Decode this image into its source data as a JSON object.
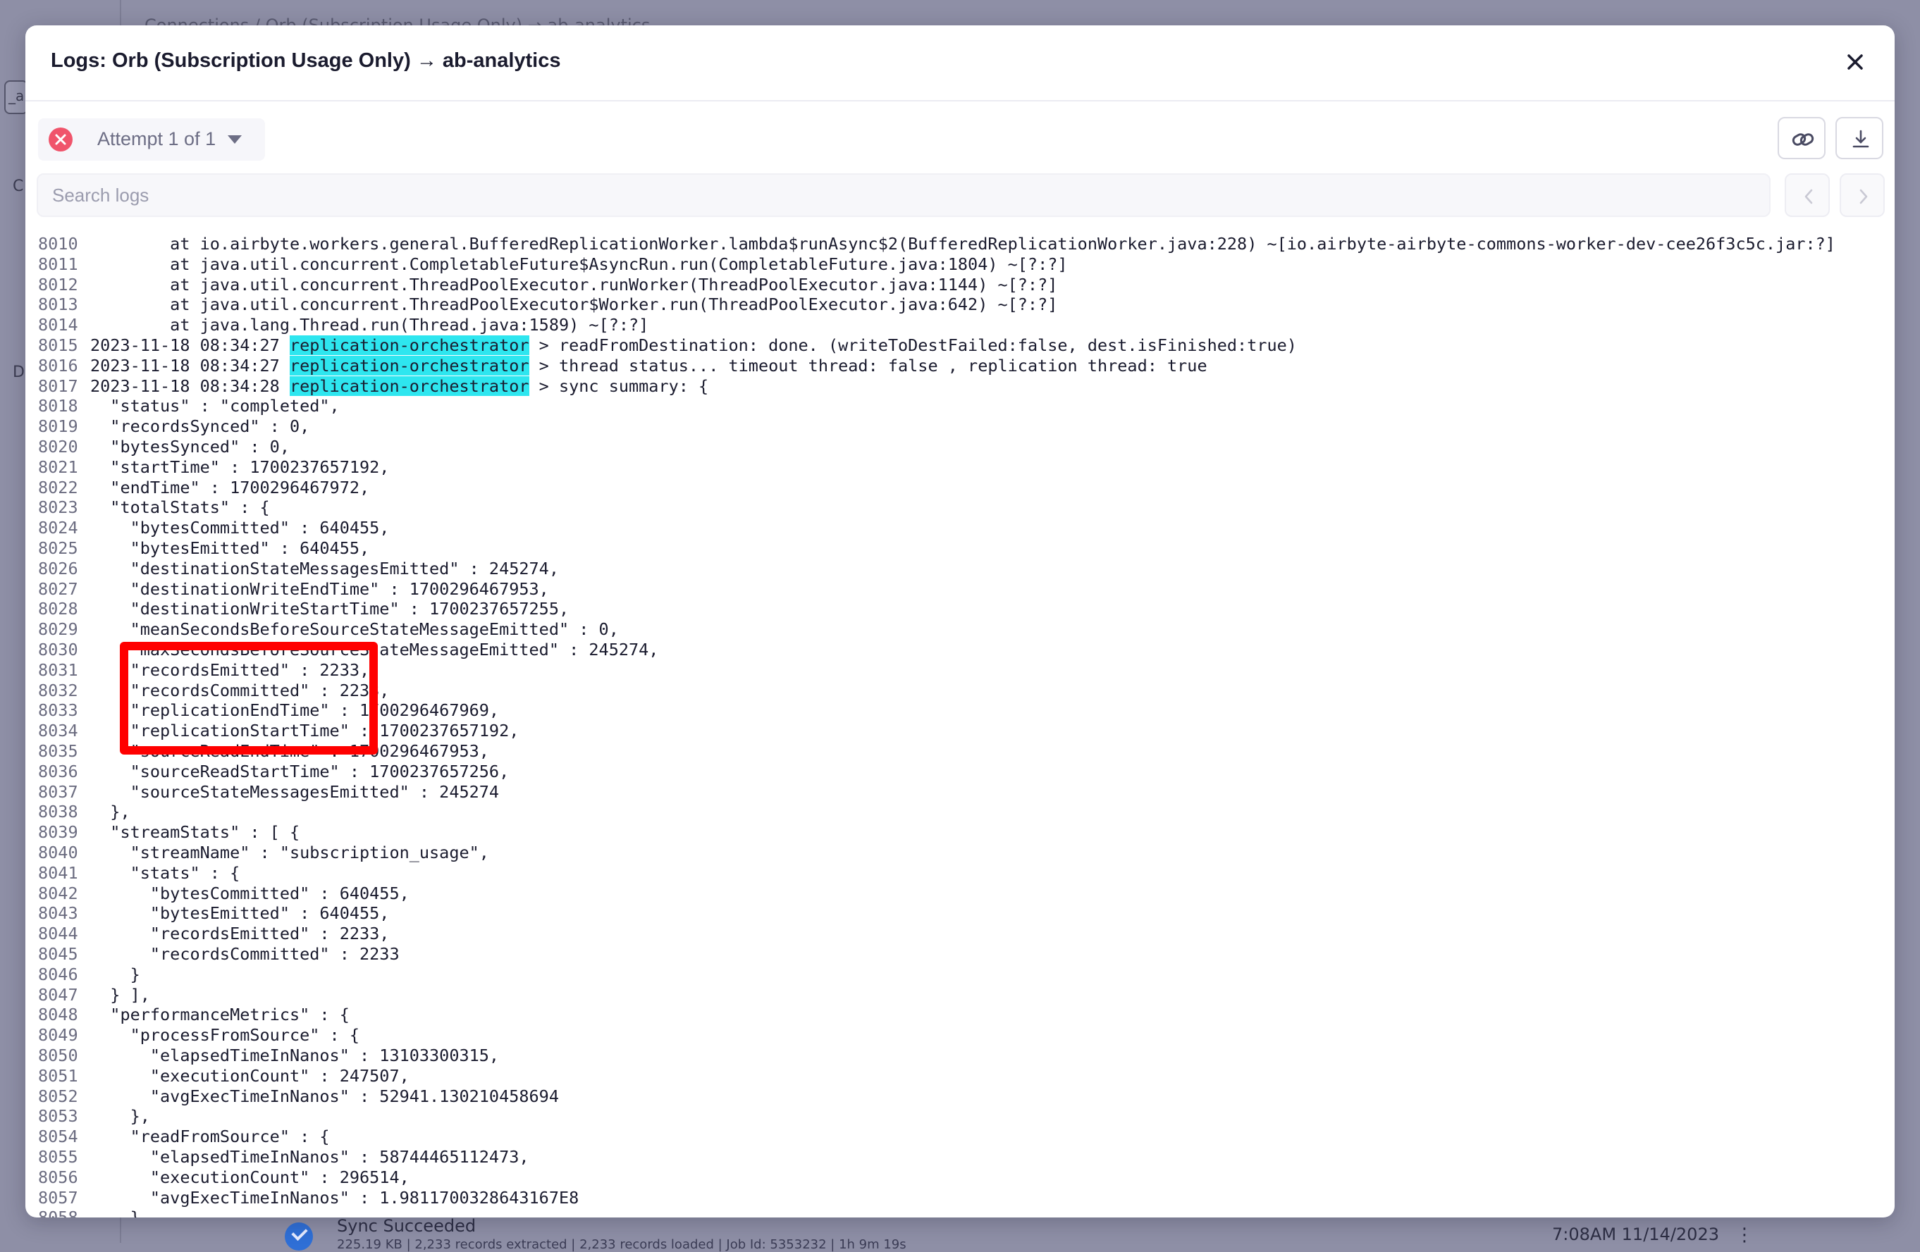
{
  "background": {
    "breadcrumb": "Connections  /  Orb (Subscription Usage Only)  →  ab-analytics",
    "sidebar_letters": [
      "_a",
      "C",
      "D"
    ],
    "sync_status": "Sync Succeeded",
    "sync_details": "225.19 KB  |  2,233 records extracted  |  2,233 records loaded  |  Job Id: 5353232  |  1h 9m 19s",
    "sync_time": "7:08AM 11/14/2023",
    "more_icon": "⋮"
  },
  "modal": {
    "title": "Logs: Orb (Subscription Usage Only) → ab-analytics",
    "attempt_label": "Attempt 1 of 1",
    "search_placeholder": "Search logs",
    "icons": {
      "close": "close-icon",
      "error": "error-circle-icon",
      "caret": "caret-down-icon",
      "link": "link-icon",
      "download": "download-icon",
      "prev": "chevron-left-icon",
      "next": "chevron-right-icon"
    },
    "colors": {
      "tag_highlight": "#2ee6ef",
      "annotation_box": "#ff0000",
      "error": "#f0546b"
    }
  },
  "logs": [
    {
      "n": "8010",
      "text": "        at io.airbyte.workers.general.BufferedReplicationWorker.lambda$runAsync$2(BufferedReplicationWorker.java:228) ~[io.airbyte-airbyte-commons-worker-dev-cee26f3c5c.jar:?]"
    },
    {
      "n": "8011",
      "text": "        at java.util.concurrent.CompletableFuture$AsyncRun.run(CompletableFuture.java:1804) ~[?:?]"
    },
    {
      "n": "8012",
      "text": "        at java.util.concurrent.ThreadPoolExecutor.runWorker(ThreadPoolExecutor.java:1144) ~[?:?]"
    },
    {
      "n": "8013",
      "text": "        at java.util.concurrent.ThreadPoolExecutor$Worker.run(ThreadPoolExecutor.java:642) ~[?:?]"
    },
    {
      "n": "8014",
      "text": "        at java.lang.Thread.run(Thread.java:1589) ~[?:?]"
    },
    {
      "n": "8015",
      "pre": "2023-11-18 08:34:27 ",
      "tag": "replication-orchestrator",
      "post": " > readFromDestination: done. (writeToDestFailed:false, dest.isFinished:true)"
    },
    {
      "n": "8016",
      "pre": "2023-11-18 08:34:27 ",
      "tag": "replication-orchestrator",
      "post": " > thread status... timeout thread: false , replication thread: true"
    },
    {
      "n": "8017",
      "pre": "2023-11-18 08:34:28 ",
      "tag": "replication-orchestrator",
      "post": " > sync summary: {"
    },
    {
      "n": "8018",
      "text": "  \"status\" : \"completed\","
    },
    {
      "n": "8019",
      "text": "  \"recordsSynced\" : 0,"
    },
    {
      "n": "8020",
      "text": "  \"bytesSynced\" : 0,"
    },
    {
      "n": "8021",
      "text": "  \"startTime\" : 1700237657192,"
    },
    {
      "n": "8022",
      "text": "  \"endTime\" : 1700296467972,"
    },
    {
      "n": "8023",
      "text": "  \"totalStats\" : {"
    },
    {
      "n": "8024",
      "text": "    \"bytesCommitted\" : 640455,"
    },
    {
      "n": "8025",
      "text": "    \"bytesEmitted\" : 640455,"
    },
    {
      "n": "8026",
      "text": "    \"destinationStateMessagesEmitted\" : 245274,"
    },
    {
      "n": "8027",
      "text": "    \"destinationWriteEndTime\" : 1700296467953,"
    },
    {
      "n": "8028",
      "text": "    \"destinationWriteStartTime\" : 1700237657255,"
    },
    {
      "n": "8029",
      "text": "    \"meanSecondsBeforeSourceStateMessageEmitted\" : 0,"
    },
    {
      "n": "8030",
      "text": "    \"maxSecondsBeforeSourceStateMessageEmitted\" : 245274,"
    },
    {
      "n": "8031",
      "text": "    \"recordsEmitted\" : 2233,"
    },
    {
      "n": "8032",
      "text": "    \"recordsCommitted\" : 2233,"
    },
    {
      "n": "8033",
      "text": "    \"replicationEndTime\" : 1700296467969,"
    },
    {
      "n": "8034",
      "text": "    \"replicationStartTime\" : 1700237657192,"
    },
    {
      "n": "8035",
      "text": "    \"sourceReadEndTime\" : 1700296467953,"
    },
    {
      "n": "8036",
      "text": "    \"sourceReadStartTime\" : 1700237657256,"
    },
    {
      "n": "8037",
      "text": "    \"sourceStateMessagesEmitted\" : 245274"
    },
    {
      "n": "8038",
      "text": "  },"
    },
    {
      "n": "8039",
      "text": "  \"streamStats\" : [ {"
    },
    {
      "n": "8040",
      "text": "    \"streamName\" : \"subscription_usage\","
    },
    {
      "n": "8041",
      "text": "    \"stats\" : {"
    },
    {
      "n": "8042",
      "text": "      \"bytesCommitted\" : 640455,"
    },
    {
      "n": "8043",
      "text": "      \"bytesEmitted\" : 640455,"
    },
    {
      "n": "8044",
      "text": "      \"recordsEmitted\" : 2233,"
    },
    {
      "n": "8045",
      "text": "      \"recordsCommitted\" : 2233"
    },
    {
      "n": "8046",
      "text": "    }"
    },
    {
      "n": "8047",
      "text": "  } ],"
    },
    {
      "n": "8048",
      "text": "  \"performanceMetrics\" : {"
    },
    {
      "n": "8049",
      "text": "    \"processFromSource\" : {"
    },
    {
      "n": "8050",
      "text": "      \"elapsedTimeInNanos\" : 13103300315,"
    },
    {
      "n": "8051",
      "text": "      \"executionCount\" : 247507,"
    },
    {
      "n": "8052",
      "text": "      \"avgExecTimeInNanos\" : 52941.130210458694"
    },
    {
      "n": "8053",
      "text": "    },"
    },
    {
      "n": "8054",
      "text": "    \"readFromSource\" : {"
    },
    {
      "n": "8055",
      "text": "      \"elapsedTimeInNanos\" : 58744465112473,"
    },
    {
      "n": "8056",
      "text": "      \"executionCount\" : 296514,"
    },
    {
      "n": "8057",
      "text": "      \"avgExecTimeInNanos\" : 1.9811700328643167E8"
    },
    {
      "n": "8058",
      "text": "    },"
    }
  ]
}
